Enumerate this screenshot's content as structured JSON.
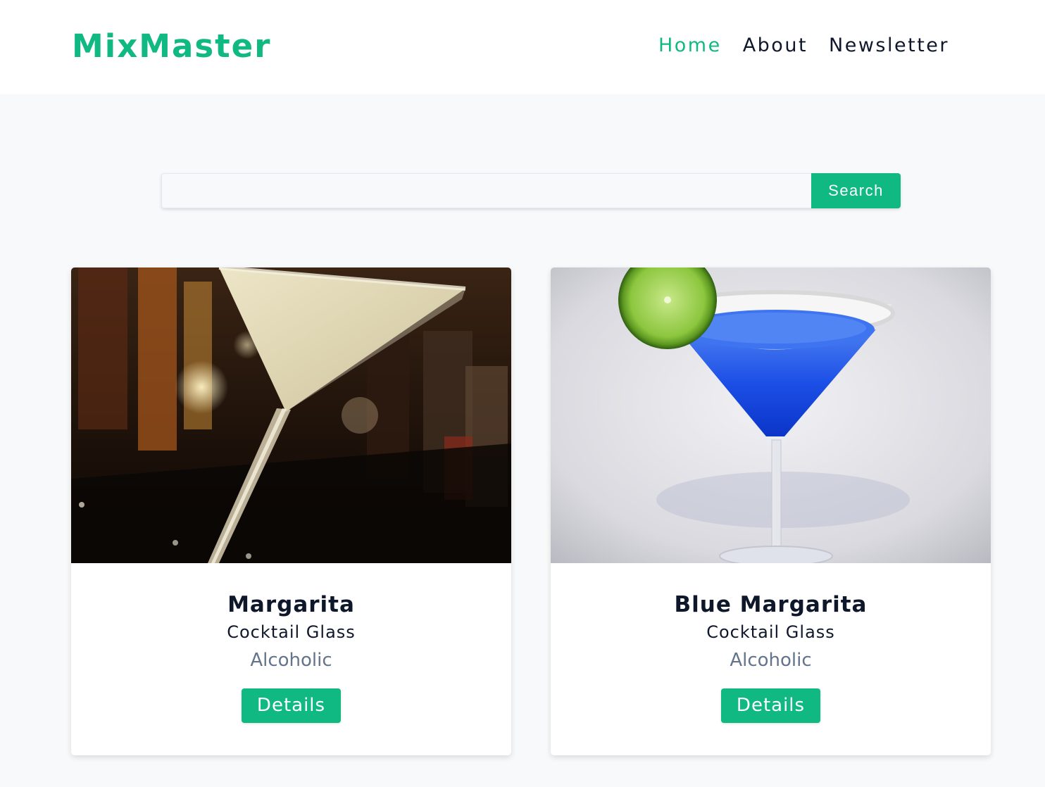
{
  "brand": {
    "name": "MixMaster"
  },
  "nav": {
    "items": [
      {
        "label": "Home",
        "active": true
      },
      {
        "label": "About",
        "active": false
      },
      {
        "label": "Newsletter",
        "active": false
      }
    ]
  },
  "search": {
    "value": "",
    "placeholder": "",
    "button_label": "Search"
  },
  "cocktails": [
    {
      "name": "Margarita",
      "glass": "Cocktail Glass",
      "type": "Alcoholic",
      "button_label": "Details"
    },
    {
      "name": "Blue Margarita",
      "glass": "Cocktail Glass",
      "type": "Alcoholic",
      "button_label": "Details"
    }
  ],
  "colors": {
    "accent": "#10b981",
    "text_dark": "#0f172a",
    "text_muted": "#64748b",
    "page_bg": "#f8f9fa"
  }
}
